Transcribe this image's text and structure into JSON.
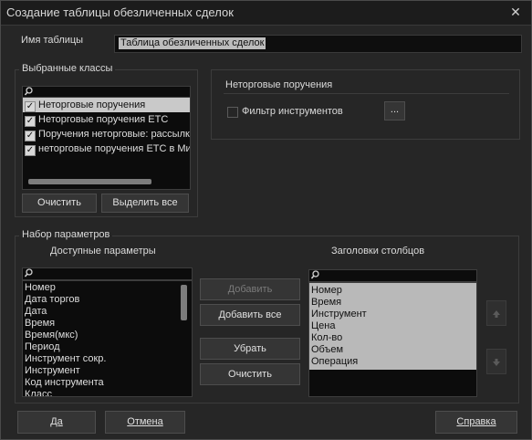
{
  "window": {
    "title": "Создание таблицы обезличенных сделок",
    "close_glyph": "✕"
  },
  "table_name": {
    "label": "Имя таблицы",
    "value": "Таблица обезличенных сделок"
  },
  "classes": {
    "title": "Выбранные классы",
    "items": [
      {
        "label": "Неторговые поручения",
        "checked": true
      },
      {
        "label": "Неторговые поручения ЕТС",
        "checked": true
      },
      {
        "label": "Поручения неторговые: рассылк",
        "checked": true
      },
      {
        "label": "неторговые поручения ЕТС в Ми",
        "checked": true
      }
    ],
    "clear_button": "Очистить",
    "select_all_button": "Выделить все"
  },
  "selected_class_panel": {
    "title": "Неторговые поручения",
    "filter_label": "Фильтр инструментов",
    "more_button": "..."
  },
  "params": {
    "title": "Набор параметров",
    "available_header": "Доступные параметры",
    "columns_header": "Заголовки столбцов",
    "available": [
      "Номер",
      "Дата торгов",
      "Дата",
      "Время",
      "Время(мкс)",
      "Период",
      "Инструмент сокр.",
      "Инструмент",
      "Код инструмента",
      "Класс"
    ],
    "columns": [
      "Номер",
      "Время",
      "Инструмент",
      "Цена",
      "Кол-во",
      "Объем",
      "Операция"
    ],
    "add_button": "Добавить",
    "add_all_button": "Добавить все",
    "remove_button": "Убрать",
    "clear_button": "Очистить"
  },
  "footer": {
    "ok": "Да",
    "cancel": "Отмена",
    "help": "Справка"
  },
  "icons": {
    "search": "search-icon",
    "up": "arrow-up-icon",
    "down": "arrow-down-icon"
  }
}
